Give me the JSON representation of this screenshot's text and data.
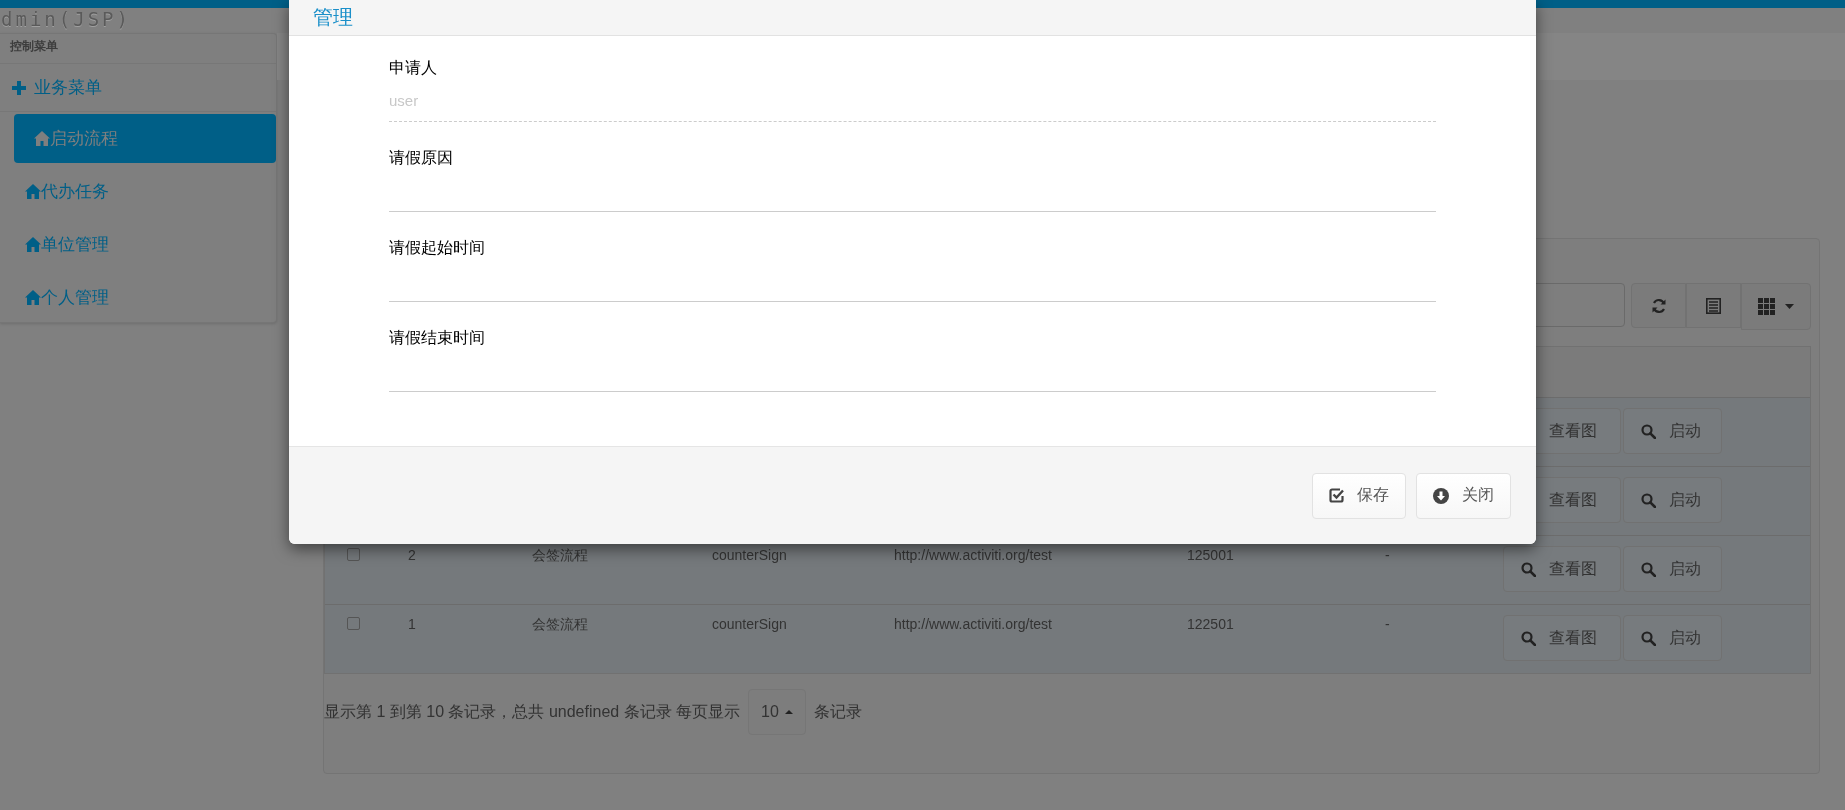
{
  "header": {
    "title": "dmin(JSP)"
  },
  "sidebar": {
    "heading": "控制菜单",
    "group": {
      "label": "业务菜单"
    },
    "items": [
      {
        "label": "启动流程",
        "selected": true
      },
      {
        "label": "代办任务",
        "selected": false
      },
      {
        "label": "单位管理",
        "selected": false
      },
      {
        "label": "个人管理",
        "selected": false
      }
    ]
  },
  "toolbar": {
    "buttons": [
      {
        "kind": "refresh"
      },
      {
        "kind": "list"
      },
      {
        "kind": "columns"
      }
    ]
  },
  "table": {
    "rows": [
      {
        "actions": [
          {
            "label": "查看图"
          },
          {
            "label": "启动"
          }
        ]
      },
      {
        "actions": [
          {
            "label": "查看图"
          },
          {
            "label": "启动"
          }
        ]
      },
      {
        "checked": false,
        "cells": [
          "2",
          "会签流程",
          "counterSign",
          "http://www.activiti.org/test",
          "125001",
          "-"
        ],
        "actions": [
          {
            "label": "查看图"
          },
          {
            "label": "启动"
          }
        ]
      },
      {
        "checked": false,
        "cells": [
          "1",
          "会签流程",
          "counterSign",
          "http://www.activiti.org/test",
          "122501",
          "-"
        ],
        "actions": [
          {
            "label": "查看图"
          },
          {
            "label": "启动"
          }
        ]
      }
    ]
  },
  "pagination": {
    "summary": "显示第 1 到第 10 条记录，总共 undefined 条记录 每页显示",
    "page_size": "10",
    "suffix": "条记录"
  },
  "dialog": {
    "title": "管理",
    "fields": [
      {
        "label": "申请人",
        "placeholder": "user",
        "readonly": true
      },
      {
        "label": "请假原因",
        "readonly": false
      },
      {
        "label": "请假起始时间",
        "readonly": false
      },
      {
        "label": "请假结束时间",
        "readonly": false
      }
    ],
    "buttons": [
      {
        "kind": "save",
        "label": "保存"
      },
      {
        "kind": "close",
        "label": "关闭"
      }
    ]
  }
}
